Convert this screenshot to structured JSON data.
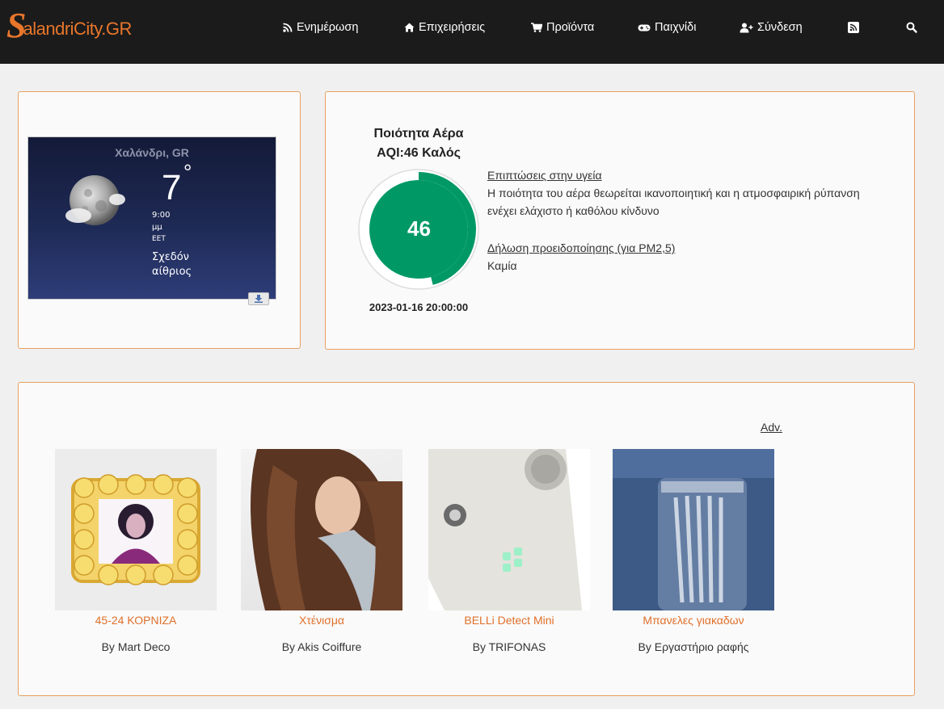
{
  "navbar": {
    "logo_letter": "S",
    "logo_text": "alandriCity.GR",
    "items": [
      {
        "label": "Ενημέρωση",
        "icon": "rss-icon"
      },
      {
        "label": "Επιχειρήσεις",
        "icon": "home-icon"
      },
      {
        "label": "Προϊόντα",
        "icon": "cart-icon"
      },
      {
        "label": "Παιχνίδι",
        "icon": "gamepad-icon"
      },
      {
        "label": "Σύνδεση",
        "icon": "user-plus-icon"
      }
    ],
    "rss_icon": "rss-square-icon",
    "search_icon": "search-icon"
  },
  "weather": {
    "city": "Χαλάνδρι, GR",
    "temp": "7",
    "deg": "°",
    "time": "9:00",
    "ampm": "μμ",
    "tz": "EET",
    "condition_line1": "Σχεδόν",
    "condition_line2": "αίθριος"
  },
  "aqi": {
    "title_line1": "Ποιότητα Αέρα",
    "title_line2": "AQI:46 Καλός",
    "value": "46",
    "gauge_fraction": 0.46,
    "color": "#009966",
    "date": "2023-01-16 20:00:00",
    "health_label": "Επιπτώσεις στην υγεία",
    "health_text_line1": "Η ποιότητα του αέρα θεωρείται ικανοποιητική και η ατμοσφαιρική ρύπανση",
    "health_text_line2": "ενέχει ελάχιστο ή καθόλου κίνδυνο",
    "warning_label": "Δήλωση προειδοποίησης (για PM2,5)",
    "warning_text": "Καμία"
  },
  "ads": {
    "label": "Adv.",
    "products": [
      {
        "name": "45-24 ΚΟΡΝΙΖΑ",
        "by": "By Mart Deco"
      },
      {
        "name": "Χτένισμα",
        "by": "By Akis Coiffure"
      },
      {
        "name": "BELLi Detect Mini",
        "by": "By TRIFONAS"
      },
      {
        "name": "Μπανελες γιακαδων",
        "by": "By Εργαστήριο ραφής"
      }
    ]
  },
  "colors": {
    "accent": "#e0702b",
    "navbar_bg": "#1b1b1b",
    "panel_border": "#e8a060",
    "aqi_good": "#009966"
  }
}
